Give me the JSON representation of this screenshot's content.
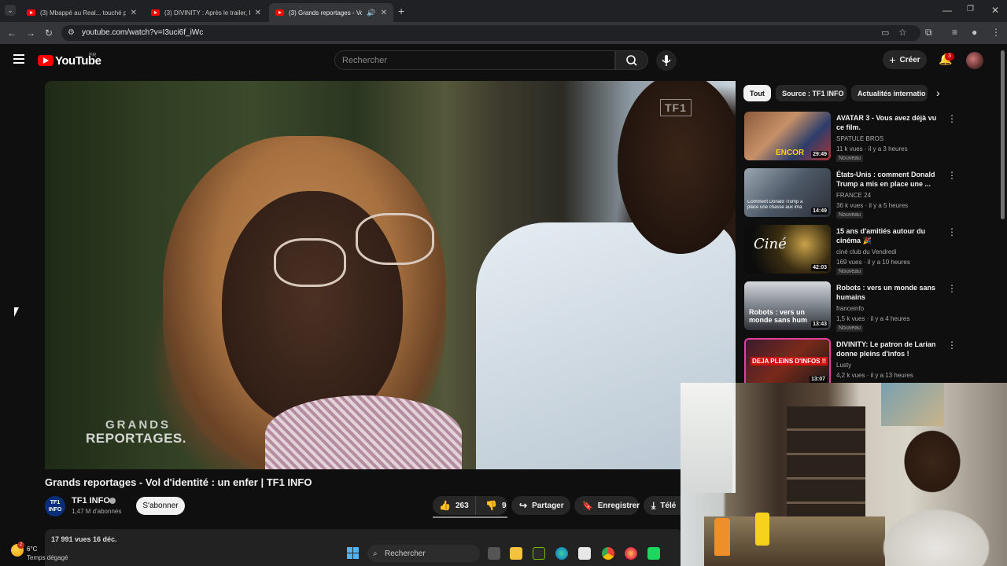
{
  "browser": {
    "tabs": [
      {
        "title": "(3) Mbappé au Real... touché p"
      },
      {
        "title": "(3) DIVINITY : Après le trailer, L"
      },
      {
        "title": "(3) Grands reportages - Vol"
      }
    ],
    "url": "youtube.com/watch?v=I3uci6f_iWc"
  },
  "youtube": {
    "logo_text": "YouTube",
    "country_code": "FR",
    "search_placeholder": "Rechercher",
    "create_label": "Créer",
    "notifications_count": "3"
  },
  "video": {
    "watermark_tf1": "TF1",
    "watermark_line1": "GRANDS",
    "watermark_line2": "REPORTAGES.",
    "title": "Grands reportages - Vol d'identité : un enfer | TF1 INFO",
    "channel_logo": "TF1 INFO",
    "channel_name": "TF1 INFO",
    "subscribers": "1,47 M d'abonnés",
    "subscribe_label": "S'abonner",
    "likes": "263",
    "dislikes": "9",
    "share_label": "Partager",
    "save_label": "Enregistrer",
    "download_label": "Télé",
    "views_date": "17 991 vues  16 déc."
  },
  "sidebar": {
    "chips": [
      "Tout",
      "Source : TF1 INFO",
      "Actualités internatio"
    ],
    "recommendations": [
      {
        "title": "AVATAR 3 - Vous avez déjà vu ce film.",
        "channel": "SPATULE BROS",
        "meta": "11 k vues · il y a 3 heures",
        "badge": "Nouveau",
        "duration": "29:49",
        "thumb_text": "ENCOR"
      },
      {
        "title": "États-Unis : comment Donald Trump a mis en place une ...",
        "channel": "FRANCE 24",
        "meta": "36 k vues · il y a 5 heures",
        "badge": "Nouveau",
        "duration": "14:49",
        "thumb_text": "Comment Donald Trump a place une chasse aux ima"
      },
      {
        "title": "15 ans d'amitiés  autour du cinéma 🎉",
        "channel": "ciné club du Vendredi",
        "meta": "169 vues · il y a 10 heures",
        "badge": "Nouveau",
        "duration": "42:03",
        "thumb_text": "Ciné"
      },
      {
        "title": "Robots : vers un monde sans humains",
        "channel": "franceinfo",
        "meta": "1,5 k vues · il y a 4 heures",
        "badge": "Nouveau",
        "duration": "13:43",
        "thumb_text": "Robots : vers un monde sans hum"
      },
      {
        "title": "DIVINITY: Le patron de Larian donne pleins d'infos !",
        "channel": "Lusty",
        "meta": "4,2 k vues · il y a 13 heures",
        "badge": "",
        "duration": "13:07",
        "thumb_text": "DEJA PLEINS D'INFOS !!"
      }
    ]
  },
  "taskbar": {
    "weather_badge": "2",
    "temperature": "6°C",
    "weather": "Temps dégagé",
    "search_label": "Rechercher"
  },
  "colors": {
    "brand": "#ff0000",
    "background": "#0f0f0f",
    "notification": "#cc0000"
  }
}
